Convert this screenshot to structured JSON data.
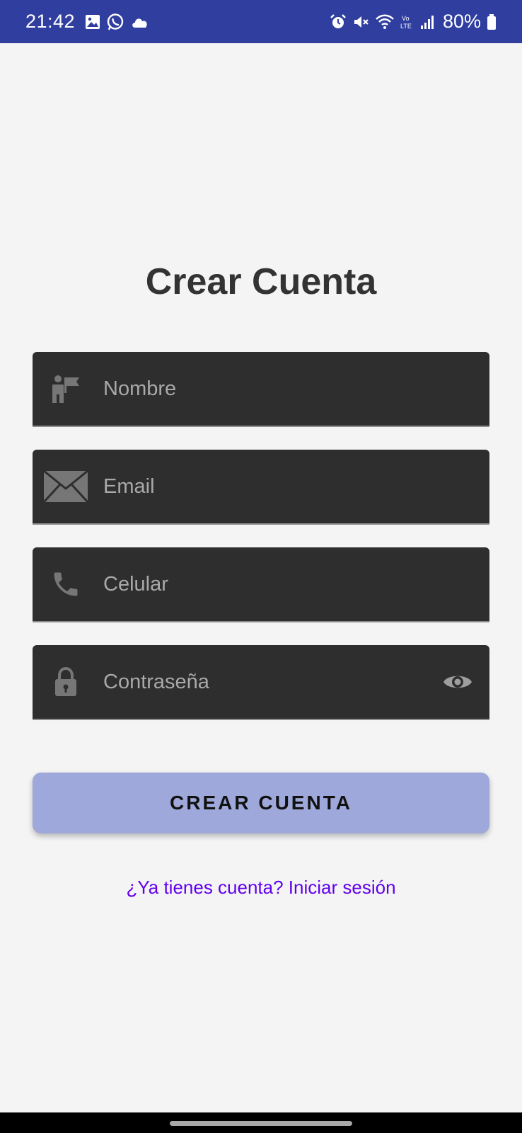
{
  "status_bar": {
    "time": "21:42",
    "battery_text": "80%",
    "left_icons": [
      "image-icon",
      "whatsapp-icon",
      "cloud-icon"
    ],
    "right_icons": [
      "alarm-icon",
      "mute-icon",
      "wifi-icon",
      "volte-icon",
      "signal-icon",
      "battery-icon"
    ],
    "color": "#303f9f"
  },
  "screen": {
    "title": "Crear Cuenta"
  },
  "form": {
    "name": {
      "placeholder": "Nombre",
      "value": "",
      "icon": "user-flag-icon"
    },
    "email": {
      "placeholder": "Email",
      "value": "",
      "icon": "envelope-icon"
    },
    "phone": {
      "placeholder": "Celular",
      "value": "",
      "icon": "phone-icon"
    },
    "password": {
      "placeholder": "Contraseña",
      "value": "",
      "icon": "lock-icon",
      "toggle_icon": "eye-icon"
    }
  },
  "actions": {
    "create_label": "CREAR CUENTA",
    "create_color": "#9fa8da",
    "login_link": "¿Ya tienes cuenta? Iniciar sesión",
    "link_color": "#6200ee"
  }
}
